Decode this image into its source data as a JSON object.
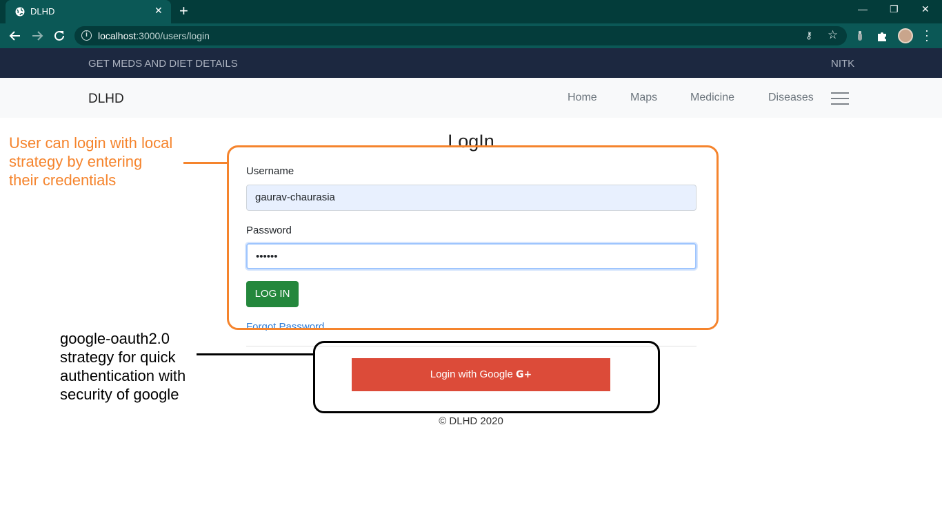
{
  "browser": {
    "tab_title": "DLHD",
    "tab_close": "✕",
    "new_tab": "+",
    "url_host": "localhost",
    "url_path": ":3000/users/login",
    "window_controls": [
      "—",
      "❐",
      "✕"
    ],
    "icons": [
      "globe-icon",
      "back-icon",
      "forward-icon",
      "reload-icon",
      "info-icon",
      "key-icon",
      "star-icon",
      "extension-icon",
      "puzzle-icon",
      "profile-avatar",
      "menu-icon"
    ]
  },
  "topbar": {
    "left_text": "GET MEDS AND DIET DETAILS",
    "right_text": "NITK"
  },
  "navbar": {
    "brand": "DLHD",
    "links": [
      "Home",
      "Maps",
      "Medicine",
      "Diseases"
    ]
  },
  "login": {
    "title": "LogIn",
    "username_label": "Username",
    "username_value": "gaurav-chaurasia",
    "password_label": "Password",
    "password_value": "••••••",
    "login_button": "LOG IN",
    "forgot_link": "Forgot Password",
    "google_button": "Login with Google",
    "google_icon_text": "G+"
  },
  "footer": {
    "copyright": "© DLHD 2020"
  },
  "annotations": {
    "orange_note": "User can login with local strategy by entering their credentials",
    "black_note": "google-oauth2.0 strategy for quick authentication with security of google",
    "orange_color": "#f5842d",
    "black_color": "#000000"
  },
  "colors": {
    "browser_frame": "#033c3a",
    "browser_toolbar": "#0b5856",
    "topbar": "#1c2840",
    "login_button": "#24873c",
    "google_button": "#dc4b39",
    "link": "#2d7cd6"
  }
}
